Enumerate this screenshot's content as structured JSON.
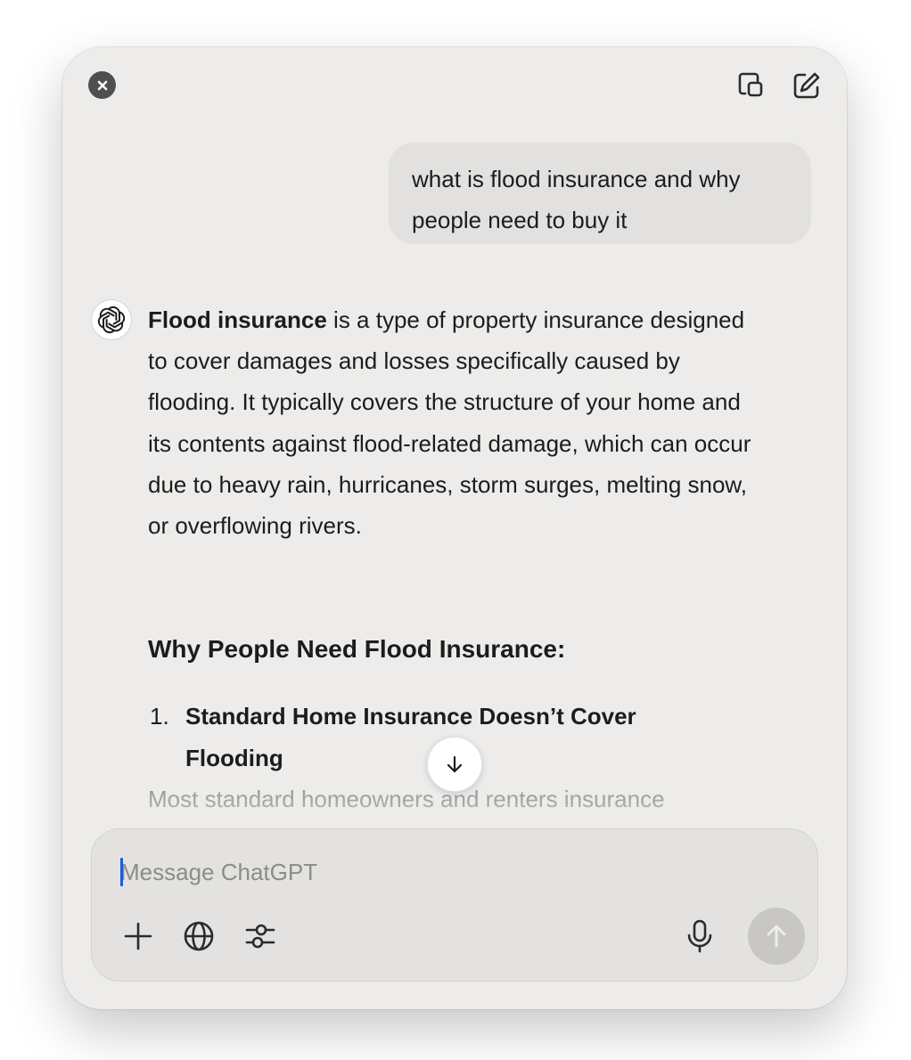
{
  "titlebar": {
    "close_icon": "close-icon",
    "popout_icon": "window-popout-icon",
    "new_chat_icon": "edit-compose-icon"
  },
  "conversation": {
    "user_message": "what is flood insurance and why people need to buy it",
    "assistant": {
      "avatar_icon": "chatgpt-logo-icon",
      "intro_bold": "Flood insurance",
      "intro_rest": " is a type of property insurance designed to cover damages and losses specifically caused by flooding. It typically covers the structure of your home and its contents against flood-related damage, which can occur due to heavy rain, hurricanes, storm surges, melting snow, or overflowing rivers.",
      "heading": "Why People Need Flood Insurance:",
      "list": [
        {
          "number": "1.",
          "title": "Standard Home Insurance Doesn’t Cover Flooding",
          "body_preview": "Most standard homeowners and renters insurance"
        }
      ]
    },
    "scroll_down_icon": "arrow-down-icon"
  },
  "composer": {
    "placeholder": "Message ChatGPT",
    "value": "",
    "tools": {
      "attach_icon": "plus-icon",
      "search_icon": "globe-icon",
      "tools_icon": "sliders-icon",
      "voice_icon": "microphone-icon",
      "send_icon": "arrow-up-icon"
    }
  },
  "colors": {
    "window_bg": "#edecea",
    "bubble_bg": "#e2e1df",
    "text": "#1c1c1c",
    "caret": "#1e5bd8",
    "send_disabled": "#c8c7c5"
  }
}
